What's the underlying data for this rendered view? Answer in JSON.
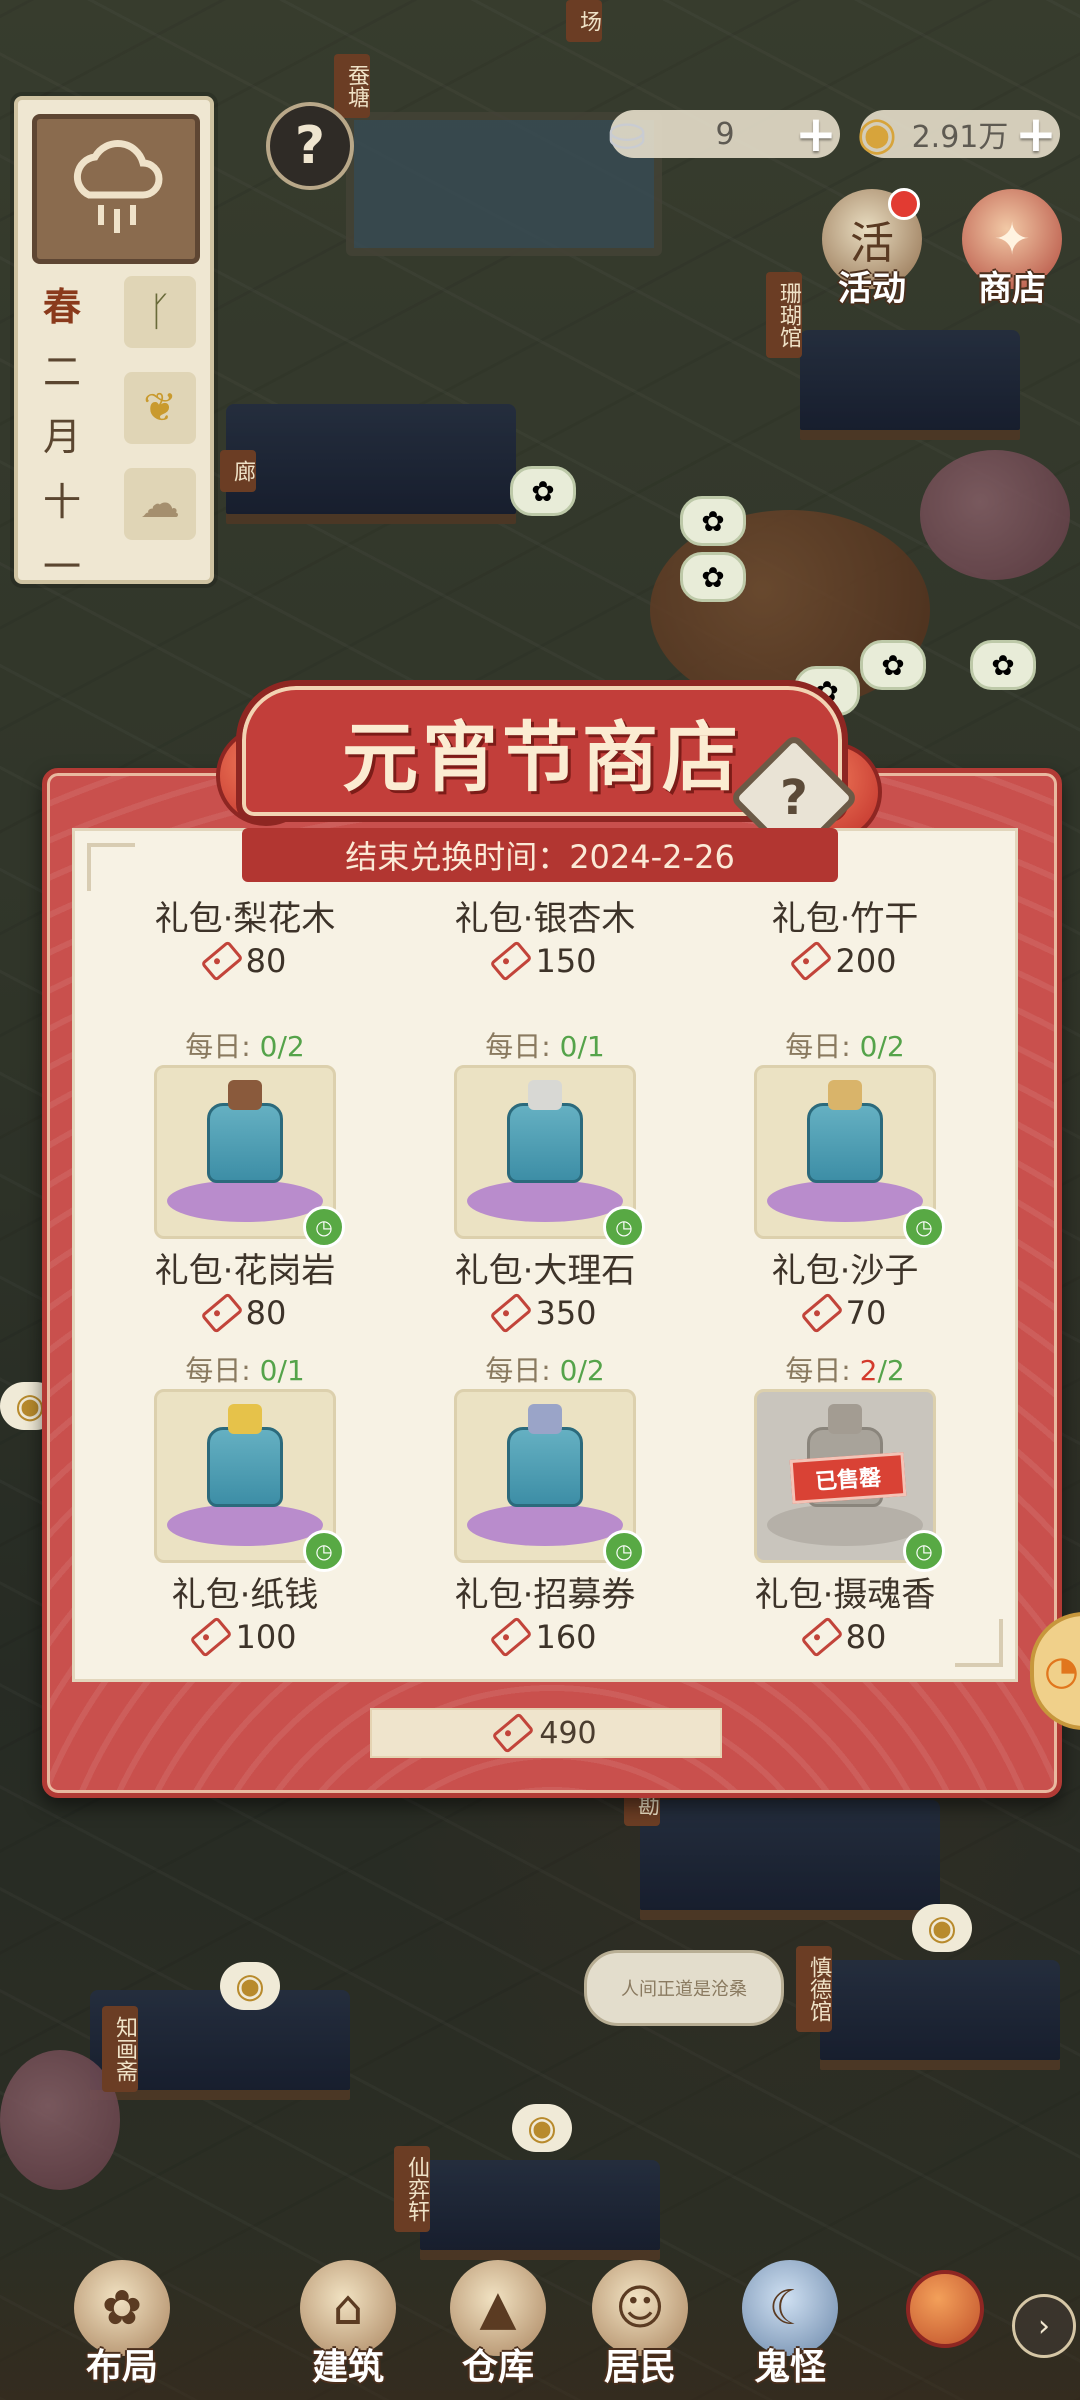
{
  "hud": {
    "weather_icon": "rain-cloud-icon",
    "season": "春",
    "date_chars": [
      "二",
      "月",
      "十",
      "一"
    ],
    "season_icons": [
      "sprout-icon",
      "wheat-icon",
      "cloud-icon"
    ],
    "help_symbol": "?",
    "silver": {
      "value": "9",
      "icon": "silver-ingot-icon",
      "plus": "+"
    },
    "coins": {
      "value": "2.91万",
      "icon": "copper-coin-icon",
      "plus": "+"
    },
    "activity_btn": {
      "label": "活动",
      "icon_char": "活",
      "has_notification": true
    },
    "shop_btn": {
      "label": "商店",
      "icon": "shop-icon"
    }
  },
  "map_labels": [
    "场",
    "蚕塘",
    "珊瑚馆",
    "廊",
    "慎德馆",
    "知画斋",
    "仙弈轩",
    "勘"
  ],
  "speech_bubble": "人间正道是沧桑",
  "shop": {
    "title": "元宵节商店",
    "help_symbol": "?",
    "end_time": "结束兑换时间：2024-2-26",
    "daily_label": "每日:",
    "currency_icon": "ticket-icon",
    "sold_out_label": "已售罄",
    "balance": "490",
    "top_row": [
      {
        "name": "礼包·梨花木",
        "price": "80"
      },
      {
        "name": "礼包·银杏木",
        "price": "150"
      },
      {
        "name": "礼包·竹干",
        "price": "200"
      }
    ],
    "items": [
      {
        "name": "礼包·花岗岩",
        "price": "80",
        "bought": "0",
        "limit": "2",
        "sold_out": false
      },
      {
        "name": "礼包·大理石",
        "price": "350",
        "bought": "0",
        "limit": "1",
        "sold_out": false
      },
      {
        "name": "礼包·沙子",
        "price": "70",
        "bought": "0",
        "limit": "2",
        "sold_out": false
      },
      {
        "name": "礼包·纸钱",
        "price": "100",
        "bought": "0",
        "limit": "1",
        "sold_out": false
      },
      {
        "name": "礼包·招募券",
        "price": "160",
        "bought": "0",
        "limit": "2",
        "sold_out": false
      },
      {
        "name": "礼包·摄魂香",
        "price": "80",
        "bought": "2",
        "limit": "2",
        "sold_out": true
      }
    ]
  },
  "bottom_nav": [
    {
      "label": "布局",
      "icon": "layout-icon"
    },
    {
      "label": "建筑",
      "icon": "building-icon"
    },
    {
      "label": "仓库",
      "icon": "warehouse-icon"
    },
    {
      "label": "居民",
      "icon": "resident-icon"
    },
    {
      "label": "鬼怪",
      "icon": "ghost-icon"
    }
  ],
  "nav_next_symbol": "›"
}
